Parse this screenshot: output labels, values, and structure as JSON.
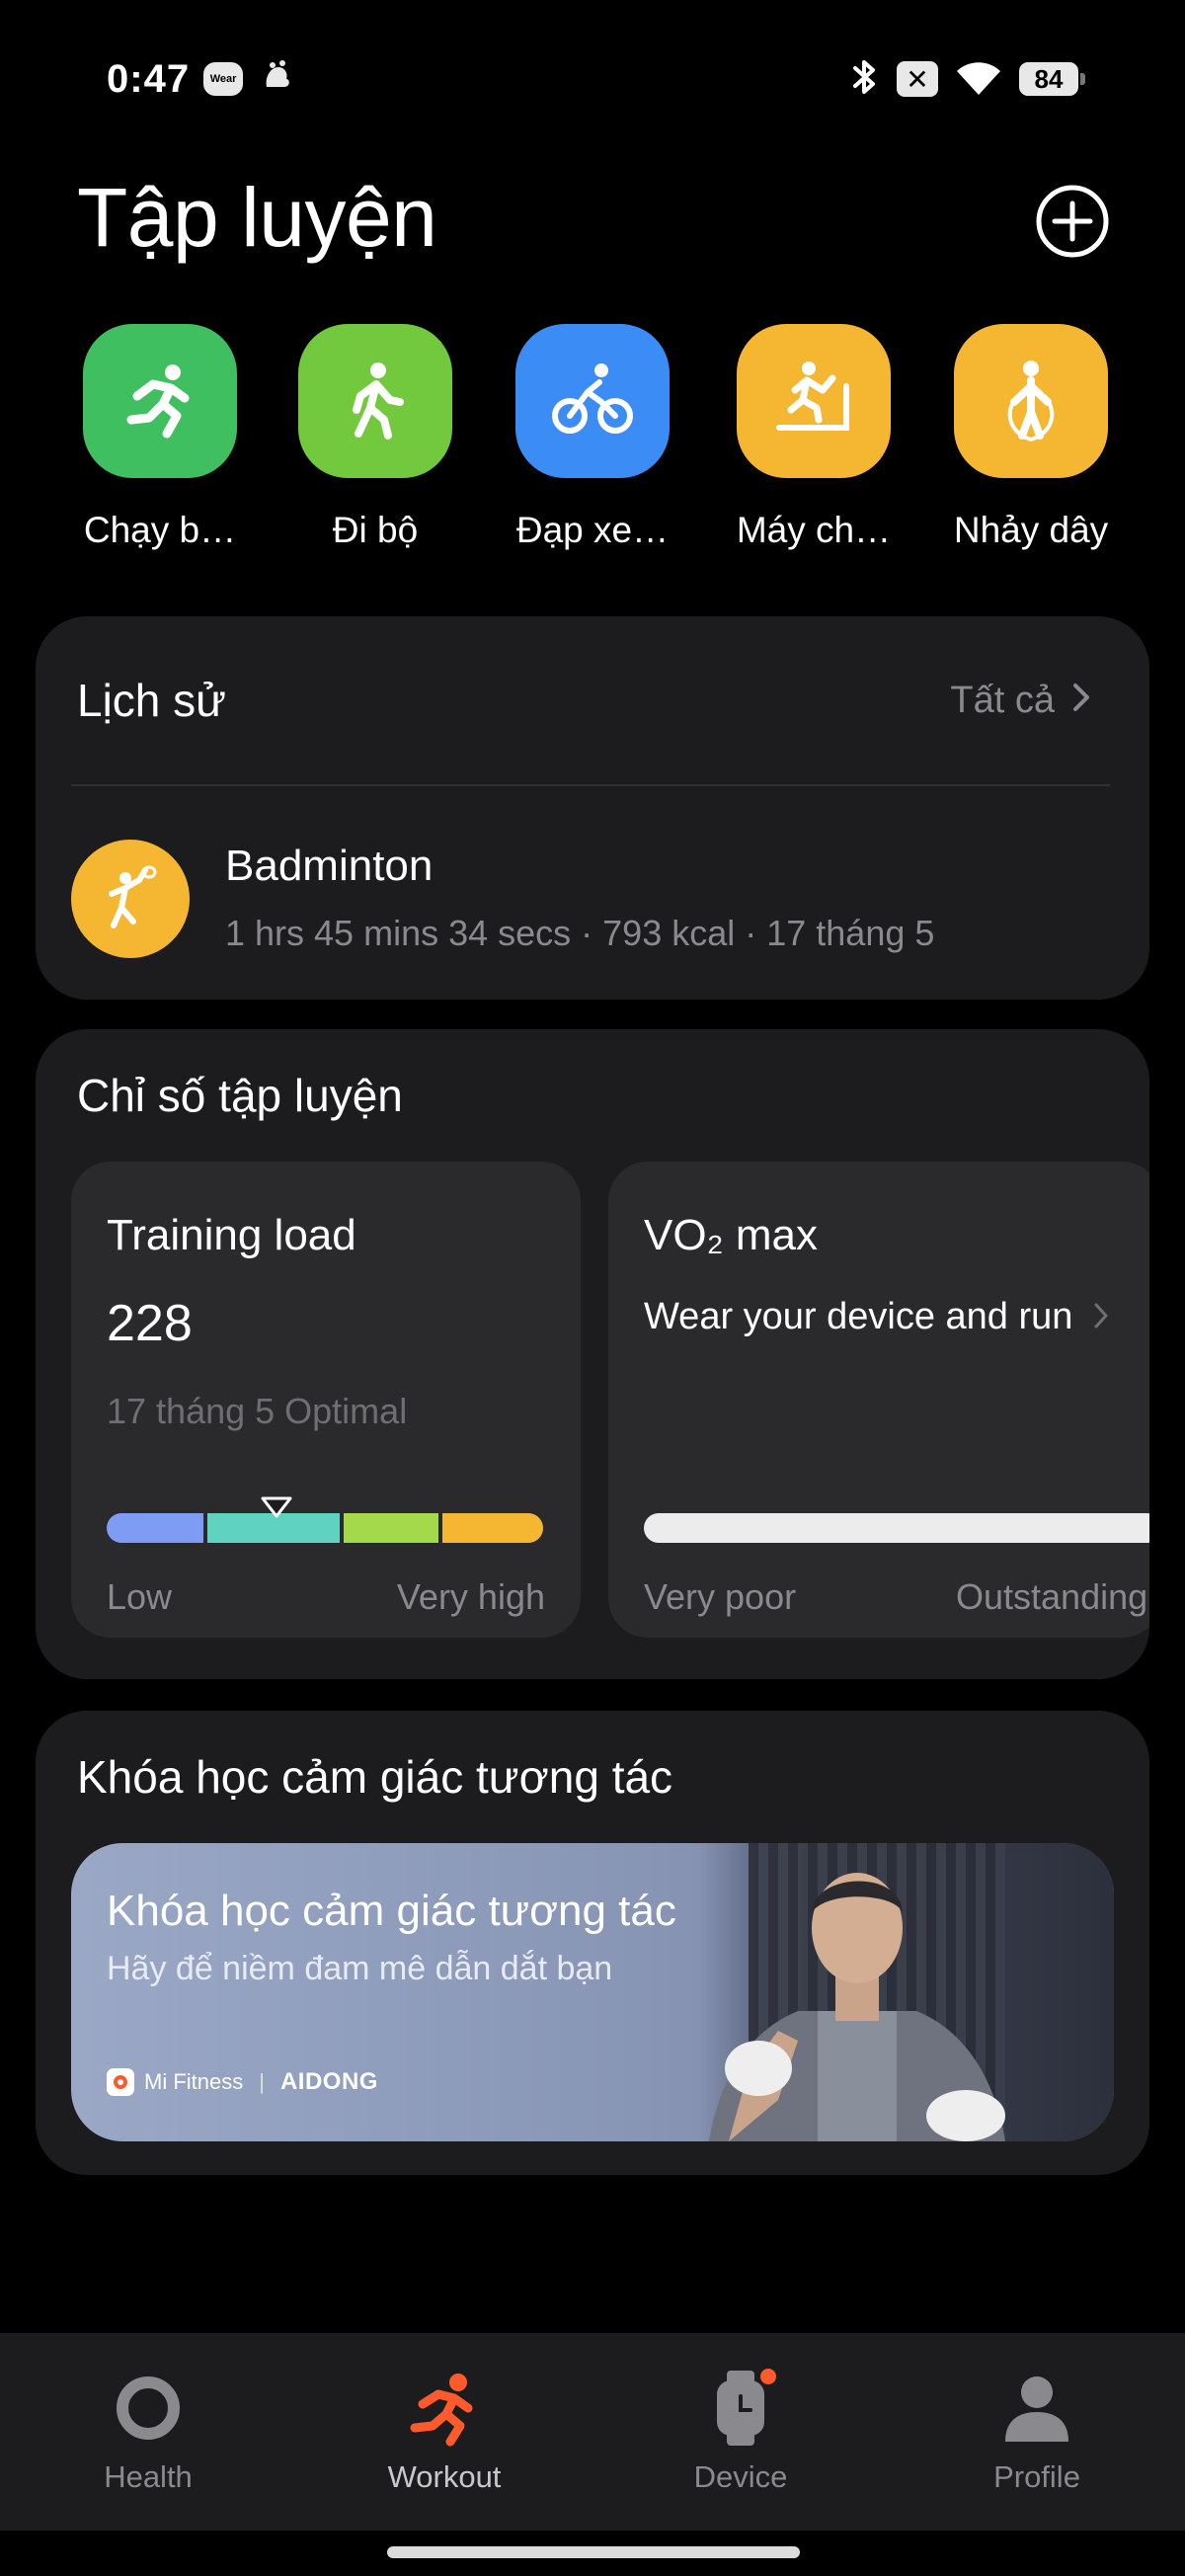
{
  "status_bar": {
    "time": "0:47",
    "wear_badge": "Wear",
    "battery": "84"
  },
  "header": {
    "title": "Tập luyện"
  },
  "quick_workouts": [
    {
      "label": "Chạy b…",
      "color": "#3fbf5f",
      "icon": "running-icon"
    },
    {
      "label": "Đi bộ",
      "color": "#72c93e",
      "icon": "walking-icon"
    },
    {
      "label": "Đạp xe…",
      "color": "#3b8df5",
      "icon": "cycling-icon"
    },
    {
      "label": "Máy ch…",
      "color": "#f5b731",
      "icon": "treadmill-icon"
    },
    {
      "label": "Nhảy dây",
      "color": "#f5b731",
      "icon": "jump-rope-icon"
    }
  ],
  "history": {
    "title": "Lịch sử",
    "see_all": "Tất cả",
    "item": {
      "name": "Badminton",
      "detail": "1 hrs 45 mins 34 secs · 793 kcal · 17 tháng 5",
      "icon": "badminton-icon",
      "color": "#f5b731"
    }
  },
  "metrics": {
    "title": "Chỉ số tập luyện",
    "training_load": {
      "title": "Training load",
      "value": "228",
      "subtitle": "17 tháng 5 Optimal",
      "scale_low": "Low",
      "scale_high": "Very high",
      "segments": [
        "#7f9cf5",
        "#5fd3c0",
        "#a3d94a",
        "#f5b731"
      ],
      "level_fraction": 0.39
    },
    "vo2max": {
      "title": "VO₂ max",
      "prompt": "Wear your device and run",
      "scale_low": "Very poor",
      "scale_high": "Outstanding"
    }
  },
  "courses": {
    "title": "Khóa học cảm giác tương tác",
    "banner": {
      "title": "Khóa học cảm giác tương tác",
      "subtitle": "Hãy để niềm đam mê dẫn dắt bạn",
      "brand_mi": "Mi Fitness",
      "brand_sep": "|",
      "brand_partner": "AIDONG"
    }
  },
  "bottom_nav": {
    "items": [
      {
        "label": "Health",
        "icon": "health-ring-icon",
        "active": false
      },
      {
        "label": "Workout",
        "icon": "workout-runner-icon",
        "active": true,
        "active_color": "#ff5a2c"
      },
      {
        "label": "Device",
        "icon": "watch-icon",
        "active": false,
        "badge": true
      },
      {
        "label": "Profile",
        "icon": "person-icon",
        "active": false
      }
    ]
  }
}
